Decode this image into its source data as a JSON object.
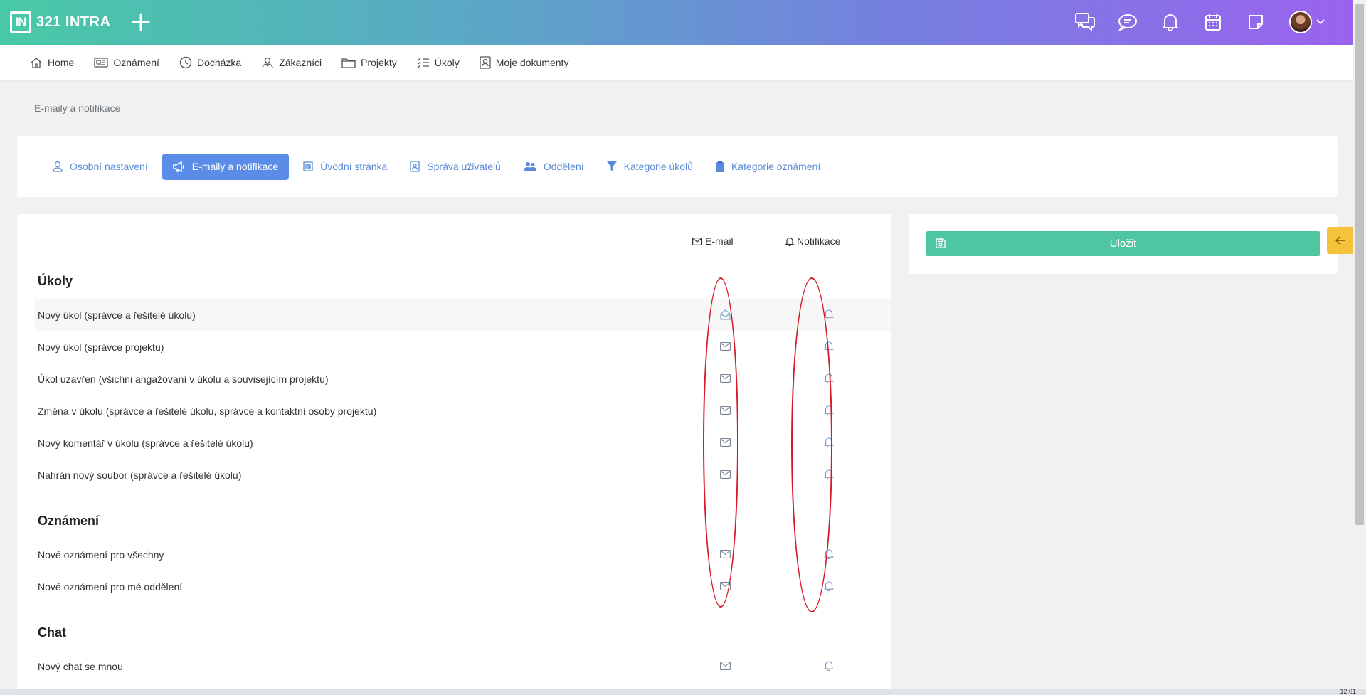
{
  "app": {
    "logo_mark": "IN",
    "logo_text": "321 INTRA"
  },
  "topbar": {
    "icons": [
      "conversations-icon",
      "chat-icon",
      "bell-icon",
      "calendar-icon",
      "note-icon",
      "avatar"
    ]
  },
  "nav": {
    "items": [
      {
        "label": "Home",
        "icon": "home-icon"
      },
      {
        "label": "Oznámení",
        "icon": "newspaper-icon"
      },
      {
        "label": "Docházka",
        "icon": "clock-icon"
      },
      {
        "label": "Zákazníci",
        "icon": "customer-icon"
      },
      {
        "label": "Projekty",
        "icon": "folder-icon"
      },
      {
        "label": "Úkoly",
        "icon": "checklist-icon"
      },
      {
        "label": "Moje dokumenty",
        "icon": "document-user-icon"
      }
    ]
  },
  "breadcrumb": "E-maily a notifikace",
  "tabs": [
    {
      "label": "Osobní nastavení",
      "icon": "user-icon",
      "active": false
    },
    {
      "label": "E-maily a notifikace",
      "icon": "megaphone-icon",
      "active": true
    },
    {
      "label": "Úvodní stránka",
      "icon": "intra-logo-icon",
      "active": false
    },
    {
      "label": "Správa uživatelů",
      "icon": "id-card-icon",
      "active": false
    },
    {
      "label": "Oddělení",
      "icon": "users-icon",
      "active": false
    },
    {
      "label": "Kategorie úkolů",
      "icon": "filter-icon",
      "active": false
    },
    {
      "label": "Kategorie oznámení",
      "icon": "clipboard-icon",
      "active": false
    }
  ],
  "columns": {
    "email": "E-mail",
    "notification": "Notifikace"
  },
  "sections": [
    {
      "title": "Úkoly",
      "rows": [
        {
          "label": "Nový úkol (správce a řešitelé úkolu)"
        },
        {
          "label": "Nový úkol (správce projektu)"
        },
        {
          "label": "Úkol uzavřen (všichni angažovaní v úkolu a souvisejícím projektu)"
        },
        {
          "label": "Změna v úkolu (správce a řešitelé úkolu, správce a kontaktní osoby projektu)"
        },
        {
          "label": "Nový komentář v úkolu (správce a řešitelé úkolu)"
        },
        {
          "label": "Nahrán nový soubor (správce a řešitelé úkolu)"
        }
      ]
    },
    {
      "title": "Oznámení",
      "rows": [
        {
          "label": "Nové oznámení pro všechny"
        },
        {
          "label": "Nové oznámení pro mé oddělení"
        }
      ]
    },
    {
      "title": "Chat",
      "rows": [
        {
          "label": "Nový chat se mnou"
        }
      ]
    }
  ],
  "save_label": "Uložit",
  "taskbar_time": "12:01",
  "colors": {
    "accent_blue": "#5b8de8",
    "save_green": "#4fc6a2",
    "toggle_yellow": "#f5c23b",
    "annotation_red": "#d7192a"
  }
}
